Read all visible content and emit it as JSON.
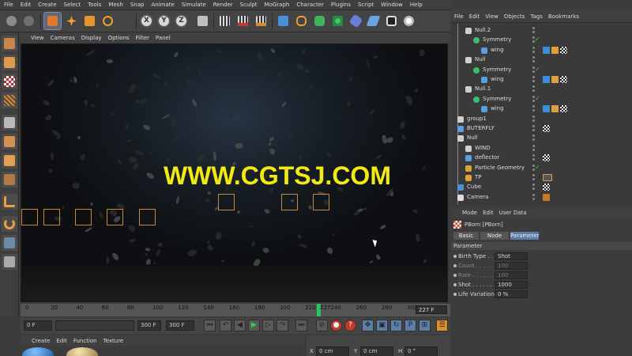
{
  "menubar": [
    "File",
    "Edit",
    "Create",
    "Select",
    "Tools",
    "Mesh",
    "Snap",
    "Animate",
    "Simulate",
    "Render",
    "Sculpt",
    "MoGraph",
    "Character",
    "Plugins",
    "Script",
    "Window",
    "Help"
  ],
  "toolbar": {
    "axis_x": "X",
    "axis_y": "Y",
    "axis_z": "Z",
    "icons": [
      "undo-icon",
      "redo-icon",
      "select-icon",
      "move-icon",
      "scale-icon",
      "rotate-icon",
      "axis-x-icon",
      "axis-y-icon",
      "axis-z-icon",
      "world-icon",
      "render-view-icon",
      "render-picture-icon",
      "render-settings-icon",
      "cube-icon",
      "spline-icon",
      "subdivision-icon",
      "cloner-icon",
      "deformer-icon",
      "floor-icon",
      "camera-icon",
      "light-icon"
    ]
  },
  "viewport": {
    "menu": [
      "View",
      "Cameras",
      "Display",
      "Options",
      "Filter",
      "Panel"
    ],
    "watermark": "WWW.CGTSJ.COM"
  },
  "timeline": {
    "ticks": [
      "0",
      "20",
      "40",
      "60",
      "80",
      "100",
      "120",
      "140",
      "160",
      "180",
      "200",
      "220",
      "240",
      "260",
      "280",
      "30("
    ],
    "current_frame": "227",
    "end_frame": "227 F",
    "current_frame_position": 0.757
  },
  "transport": {
    "start_field": "0 F",
    "min_field": "",
    "max_field": "300 F",
    "end_field": "300 F"
  },
  "material": {
    "menu": [
      "Create",
      "Edit",
      "Function",
      "Texture"
    ]
  },
  "coordinates": {
    "x_label": "X",
    "x_value": "0 cm",
    "y_label": "Y",
    "y_value": "0 cm",
    "h_label": "H",
    "h_value": "0 °"
  },
  "objects": {
    "menu": [
      "File",
      "Edit",
      "View",
      "Objects",
      "Tags",
      "Bookmarks"
    ],
    "rows": [
      {
        "label": "Null.2",
        "icon": "null-icon",
        "indent": 1
      },
      {
        "label": "Symmetry",
        "icon": "symmetry-icon",
        "indent": 2
      },
      {
        "label": "wing",
        "icon": "polygon-icon",
        "indent": 3
      },
      {
        "label": "Null",
        "icon": "null-icon",
        "indent": 1
      },
      {
        "label": "Symmetry",
        "icon": "symmetry-icon",
        "indent": 2
      },
      {
        "label": "wing",
        "icon": "polygon-icon",
        "indent": 3
      },
      {
        "label": "Null.1",
        "icon": "null-icon",
        "indent": 1
      },
      {
        "label": "Symmetry",
        "icon": "symmetry-icon",
        "indent": 2
      },
      {
        "label": "wing",
        "icon": "polygon-icon",
        "indent": 3
      },
      {
        "label": "group1",
        "icon": "group-icon",
        "indent": 0
      },
      {
        "label": "BUTERFLY",
        "icon": "polygon-icon",
        "indent": 0
      },
      {
        "label": "Null",
        "icon": "null-icon",
        "indent": 0
      },
      {
        "label": "WIND",
        "icon": "null-icon",
        "indent": 1
      },
      {
        "label": "deflector",
        "icon": "deflector-icon",
        "indent": 1
      },
      {
        "label": "Particle Geometry",
        "icon": "particle-icon",
        "indent": 1
      },
      {
        "label": "TP",
        "icon": "tp-icon",
        "indent": 1
      },
      {
        "label": "Cube",
        "icon": "cube-icon",
        "indent": 0
      },
      {
        "label": "Camera",
        "icon": "camera-icon",
        "indent": 0
      }
    ]
  },
  "attributes": {
    "menu": [
      "Mode",
      "Edit",
      "User Data"
    ],
    "object_title": "PBorn [PBorn]",
    "tabs": [
      "Basic",
      "Node",
      "Parameter"
    ],
    "active_tab": "Parameter",
    "section": "Parameter",
    "params": [
      {
        "label": "Birth Type . .",
        "value": "Shot",
        "dim": false
      },
      {
        "label": "Count . . . . . .",
        "value": "100",
        "dim": true
      },
      {
        "label": "Rate . . . . . . .",
        "value": "100",
        "dim": true
      },
      {
        "label": "Shot . . . . . . .",
        "value": "1000",
        "dim": false
      },
      {
        "label": "Life Variation",
        "value": "0 %",
        "dim": false
      }
    ]
  },
  "colors": {
    "accent": "#5c7ba6",
    "watermark": "#f2ea10",
    "timeline_cursor": "#22c85a",
    "checkmark": "#33d23a"
  }
}
